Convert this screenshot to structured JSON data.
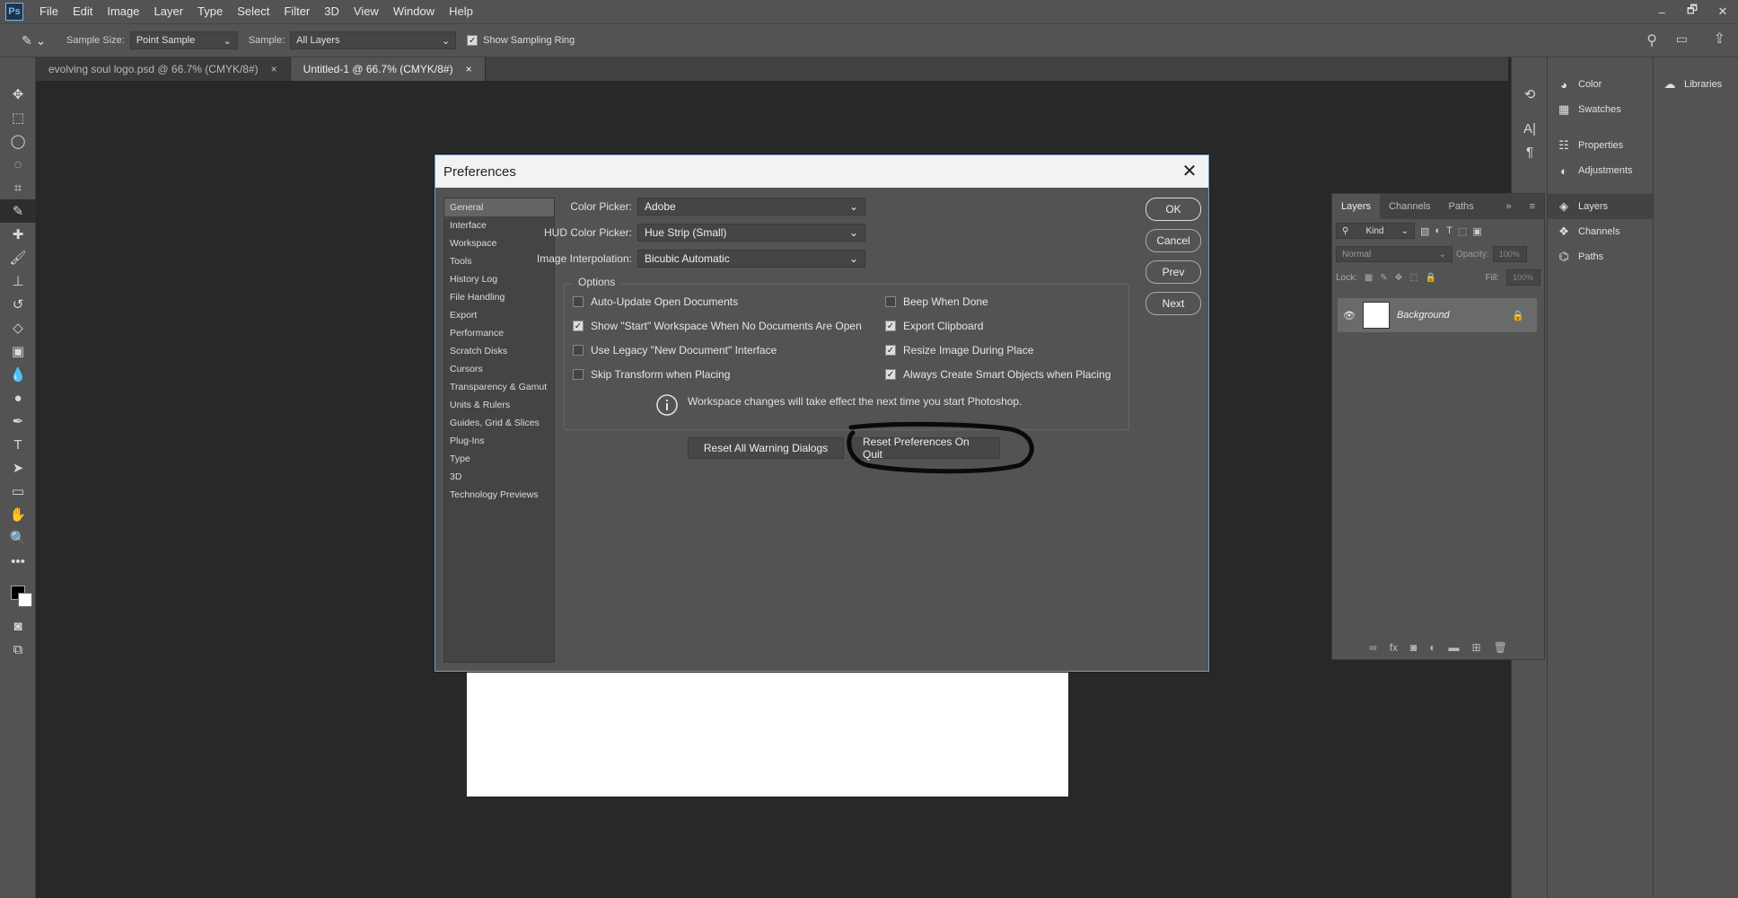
{
  "app": {
    "logo": "Ps",
    "menus": [
      "File",
      "Edit",
      "Image",
      "Layer",
      "Type",
      "Select",
      "Filter",
      "3D",
      "View",
      "Window",
      "Help"
    ],
    "window_controls": [
      "–",
      "🗗",
      "✕"
    ]
  },
  "options_bar": {
    "sample_size_label": "Sample Size:",
    "sample_size_value": "Point Sample",
    "sample_label": "Sample:",
    "sample_value": "All Layers",
    "show_sampling_ring_label": "Show Sampling Ring"
  },
  "doc_tabs": [
    {
      "label": "evolving soul logo.psd @ 66.7% (CMYK/8#)",
      "close": "×"
    },
    {
      "label": "Untitled-1 @ 66.7% (CMYK/8#)",
      "close": "×"
    }
  ],
  "right_panels": {
    "icon_strip": [
      "A|",
      "¶"
    ],
    "column": [
      "Color",
      "Swatches",
      "Properties",
      "Adjustments",
      "Layers",
      "Channels",
      "Paths"
    ],
    "libraries": "Libraries"
  },
  "layers_panel": {
    "tabs": [
      "Layers",
      "Channels",
      "Paths"
    ],
    "kind_label": "Kind",
    "blend_mode": "Normal",
    "opacity_label": "Opacity:",
    "opacity_value": "100%",
    "lock_label": "Lock:",
    "fill_label": "Fill:",
    "fill_value": "100%",
    "layer_name": "Background"
  },
  "dialog": {
    "title": "Preferences",
    "nav": [
      "General",
      "Interface",
      "Workspace",
      "Tools",
      "History Log",
      "File Handling",
      "Export",
      "Performance",
      "Scratch Disks",
      "Cursors",
      "Transparency & Gamut",
      "Units & Rulers",
      "Guides, Grid & Slices",
      "Plug-Ins",
      "Type",
      "3D",
      "Technology Previews"
    ],
    "color_picker_label": "Color Picker:",
    "color_picker_value": "Adobe",
    "hud_label": "HUD Color Picker:",
    "hud_value": "Hue Strip (Small)",
    "interp_label": "Image Interpolation:",
    "interp_value": "Bicubic Automatic",
    "options_label": "Options",
    "options_left": [
      {
        "label": "Auto-Update Open Documents",
        "checked": false
      },
      {
        "label": "Show \"Start\" Workspace When No Documents Are Open",
        "checked": true
      },
      {
        "label": "Use Legacy \"New Document\" Interface",
        "checked": false
      },
      {
        "label": "Skip Transform when Placing",
        "checked": false
      }
    ],
    "options_right": [
      {
        "label": "Beep When Done",
        "checked": false
      },
      {
        "label": "Export Clipboard",
        "checked": true
      },
      {
        "label": "Resize Image During Place",
        "checked": true
      },
      {
        "label": "Always Create Smart Objects when Placing",
        "checked": true
      }
    ],
    "info_text": "Workspace changes will take effect the next time you start Photoshop.",
    "reset_warnings": "Reset All Warning Dialogs",
    "reset_prefs": "Reset Preferences On Quit",
    "buttons": {
      "ok": "OK",
      "cancel": "Cancel",
      "prev": "Prev",
      "next": "Next"
    }
  }
}
